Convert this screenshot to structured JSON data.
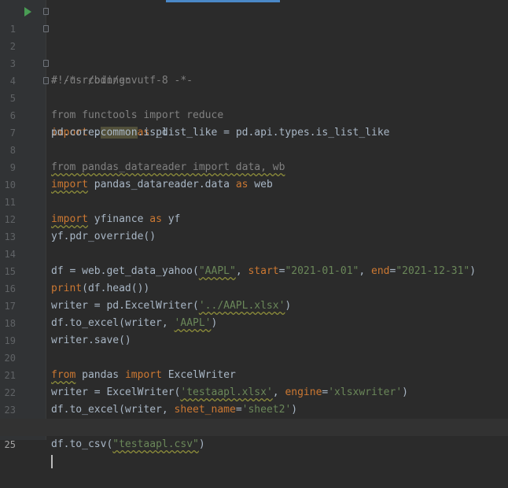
{
  "editor": {
    "lines": [
      {
        "n": "1",
        "c": "#!/usr/bin/env"
      },
      {
        "n": "2",
        "c": "# -*- coding: utf-8 -*-"
      },
      {
        "n": "3",
        "c": ""
      },
      {
        "n": "4",
        "c": "from functools import reduce"
      },
      {
        "n": "5",
        "a": "import",
        "b": " pandas ",
        "d": "as",
        "e": " pd"
      },
      {
        "n": "6",
        "a": "pd.core.",
        "b": "common",
        "d": ".is_list_like = pd.api.types.is_list_like"
      },
      {
        "n": "7",
        "c": ""
      },
      {
        "n": "8",
        "c": "from pandas_datareader import data, wb"
      },
      {
        "n": "9",
        "a": "import",
        "b": " pandas_datareader.data ",
        "d": "as",
        "e": " web"
      },
      {
        "n": "10",
        "c": ""
      },
      {
        "n": "11",
        "a": "import",
        "b": " yfinance ",
        "d": "as",
        "e": " yf"
      },
      {
        "n": "12",
        "c": "yf.pdr_override()"
      },
      {
        "n": "13",
        "c": ""
      },
      {
        "n": "14",
        "a": "df = web.get_data_yahoo(",
        "b": "\"AAPL\"",
        "d": ", ",
        "e": "start",
        "f": "=",
        "g": "\"2021-01-01\"",
        "h": ", ",
        "i": "end",
        "j": "=",
        "k": "\"2021-12-31\"",
        "l": ")"
      },
      {
        "n": "15",
        "a": "print",
        "b": "(df.head())"
      },
      {
        "n": "16",
        "a": "writer = pd.ExcelWriter(",
        "b": "'../AAPL.xlsx'",
        "d": ")"
      },
      {
        "n": "17",
        "a": "df.to_excel(writer, ",
        "b": "'AAPL'",
        "d": ")"
      },
      {
        "n": "18",
        "c": "writer.save()"
      },
      {
        "n": "19",
        "c": ""
      },
      {
        "n": "20",
        "a": "from",
        "b": " pandas ",
        "d": "import",
        "e": " ExcelWriter"
      },
      {
        "n": "21",
        "a": "writer = ExcelWriter(",
        "b": "'testaapl.xlsx'",
        "d": ", ",
        "e": "engine",
        "f": "=",
        "g": "'xlsxwriter'",
        "h": ")"
      },
      {
        "n": "22",
        "a": "df.to_excel(writer, ",
        "b": "sheet_name",
        "d": "=",
        "e": "'sheet2'",
        "f": ")"
      },
      {
        "n": "23",
        "c": ""
      },
      {
        "n": "24",
        "a": "df.to_csv(",
        "b": "\"testaapl.csv\"",
        "d": ")"
      },
      {
        "n": "25",
        "c": ""
      }
    ]
  }
}
